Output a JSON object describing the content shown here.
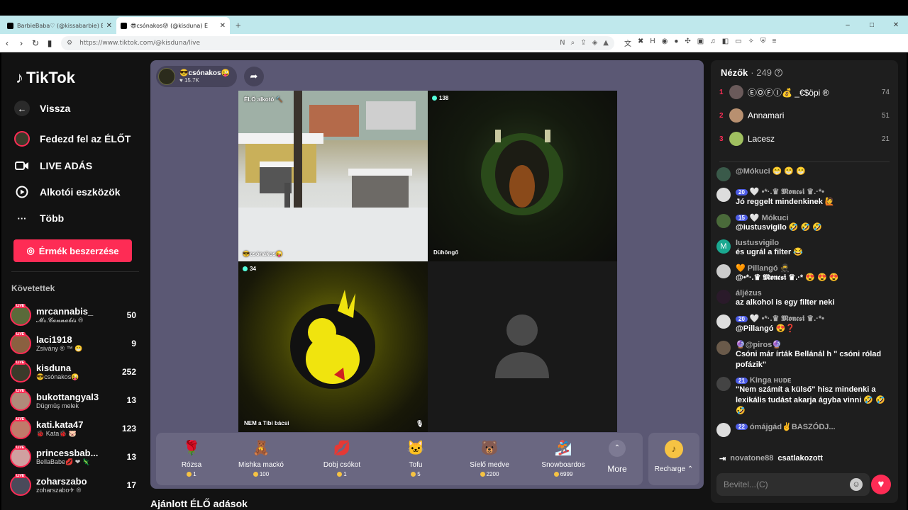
{
  "browser": {
    "tabs": [
      {
        "title": "BarbieBaba♡ (@kissabarbie) ÉLŐ ad",
        "active": false
      },
      {
        "title": "😎csónakos😜 (@kisduna) É",
        "active": true
      }
    ],
    "new_tab": "+",
    "url": "https://www.tiktok.com/@kisduna/live",
    "window_controls": [
      "–",
      "□",
      "✕"
    ]
  },
  "sidebar": {
    "logo": "TikTok",
    "nav": [
      {
        "label": "Vissza",
        "icon": "back-arrow-icon"
      },
      {
        "label": "Fedezd fel az ÉLŐT",
        "icon": "explore-live-icon"
      },
      {
        "label": "LIVE ADÁS",
        "icon": "video-camera-icon"
      },
      {
        "label": "Alkotói eszközök",
        "icon": "creator-tools-icon"
      },
      {
        "label": "Több",
        "icon": "more-dots-icon"
      }
    ],
    "coin_button": "Érmék beszerzése",
    "following_header": "Követettek",
    "live_badge": "LIVE",
    "following": [
      {
        "name": "mrcannabis_",
        "sub": "𝓜𝓻.𝓒𝓪𝓷𝓷𝓪𝓫𝓲𝓼 ®",
        "count": "50",
        "color": "#5a6a3a"
      },
      {
        "name": "laci1918",
        "sub": "Zsivány ® ™ 😁",
        "count": "9",
        "color": "#8a6040"
      },
      {
        "name": "kisduna",
        "sub": "😎csónakos😜",
        "count": "252",
        "color": "#3a3a2a"
      },
      {
        "name": "bukottangyal3",
        "sub": "Dügmüş melek",
        "count": "13",
        "color": "#b08a7a"
      },
      {
        "name": "kati.kata47",
        "sub": "🐞 Kata🐞 🐷",
        "count": "123",
        "color": "#c07a6a"
      },
      {
        "name": "princessbab...",
        "sub": "BellaBabe💋 ❤ 🦎",
        "count": "13",
        "color": "#d0a0a0"
      },
      {
        "name": "zoharszabo",
        "sub": "zoharszabo✈ ®",
        "count": "17",
        "color": "#4a4a5a"
      }
    ]
  },
  "stream": {
    "host_name": "😎csónakos😜",
    "host_likes": "♥ 15.7K",
    "cells": [
      {
        "label": "😎csónakos😜",
        "badge": "ÉLŐ alkotó 🔨"
      },
      {
        "label": "Dühöngő",
        "viewers": "138"
      },
      {
        "label": "NEM a Tibi bácsi",
        "viewers": "34"
      },
      {
        "label": ""
      }
    ],
    "gifts": [
      {
        "name": "Rózsa",
        "price": "1",
        "icon": "🌹"
      },
      {
        "name": "Mishka mackó",
        "price": "100",
        "icon": "🧸"
      },
      {
        "name": "Dobj csókot",
        "price": "1",
        "icon": "💋"
      },
      {
        "name": "Tofu",
        "price": "5",
        "icon": "🐱"
      },
      {
        "name": "Síelő medve",
        "price": "2200",
        "icon": "🐻"
      },
      {
        "name": "Snowboardos",
        "price": "6999",
        "icon": "🏂"
      }
    ],
    "more_label": "More",
    "recharge_label": "Recharge ⌃",
    "recommended": "Ajánlott ÉLŐ adások"
  },
  "panel": {
    "viewers_title": "Nézők",
    "viewers_count": "· 249",
    "top": [
      {
        "rank": "1",
        "name": "ⒺⓄⒻⒾ💰 _€$öpi ®",
        "score": "74",
        "color": "#6a5a5a"
      },
      {
        "rank": "2",
        "name": "Annamari",
        "score": "51",
        "color": "#b89070"
      },
      {
        "rank": "3",
        "name": "Lacesz",
        "score": "21",
        "color": "#a0c060"
      }
    ],
    "messages": [
      {
        "user": "@Mókuci 😁 😁 😁",
        "level": "",
        "text": "",
        "color": "#3a5a4a"
      },
      {
        "user": "🤍 •*·.♛ 𝕸𝖔𝖓𝖈𝖘𝖎 ♛.·*•",
        "level": "20",
        "text": "Jó reggelt mindenkinek 🙋",
        "color": "#ddd"
      },
      {
        "user": "🤍 Mókuci",
        "level": "15",
        "text": "@iustusvigilo 🤣 🤣 🤣",
        "color": "#4a6a3a"
      },
      {
        "user": "Iustusvigilo",
        "level": "",
        "text": "és ugrál a filter 😂",
        "color": "#1aa890"
      },
      {
        "user": "🧡 Pillangó 🥷",
        "level": "",
        "text": "@•*·.♛ 𝕸𝖔𝖓𝖈𝖘𝖎 ♛.·* 😍 😍 😍",
        "color": "#ccc"
      },
      {
        "user": "áljézus",
        "level": "",
        "text": "az alkohol is egy filter neki",
        "color": "#2a1a2a"
      },
      {
        "user": "🤍 •*·.♛ 𝕸𝖔𝖓𝖈𝖘𝖎 ♛.·*•",
        "level": "20",
        "text": "@Pillangó 😍❓",
        "color": "#ddd"
      },
      {
        "user": "🔮@piros🔮",
        "level": "",
        "text": "Csóni már írták Bellánál h \" csóni rólad pofázik\"",
        "color": "#6a5a4a"
      },
      {
        "user": "Kinga ʜᴜᴅᴇ",
        "level": "21",
        "text": "\"Nem számít a külső\" hisz mindenki a lexikális tudást akarja ágyba vinni 🤣 🤣 🤣",
        "color": "#444"
      },
      {
        "user": "ómájgád✌️BASZÓDJ...",
        "level": "22",
        "text": "",
        "color": "#ddd"
      }
    ],
    "join_user": "novatone88",
    "join_text": "csatlakozott",
    "input_placeholder": "Bevitel...(C)"
  }
}
